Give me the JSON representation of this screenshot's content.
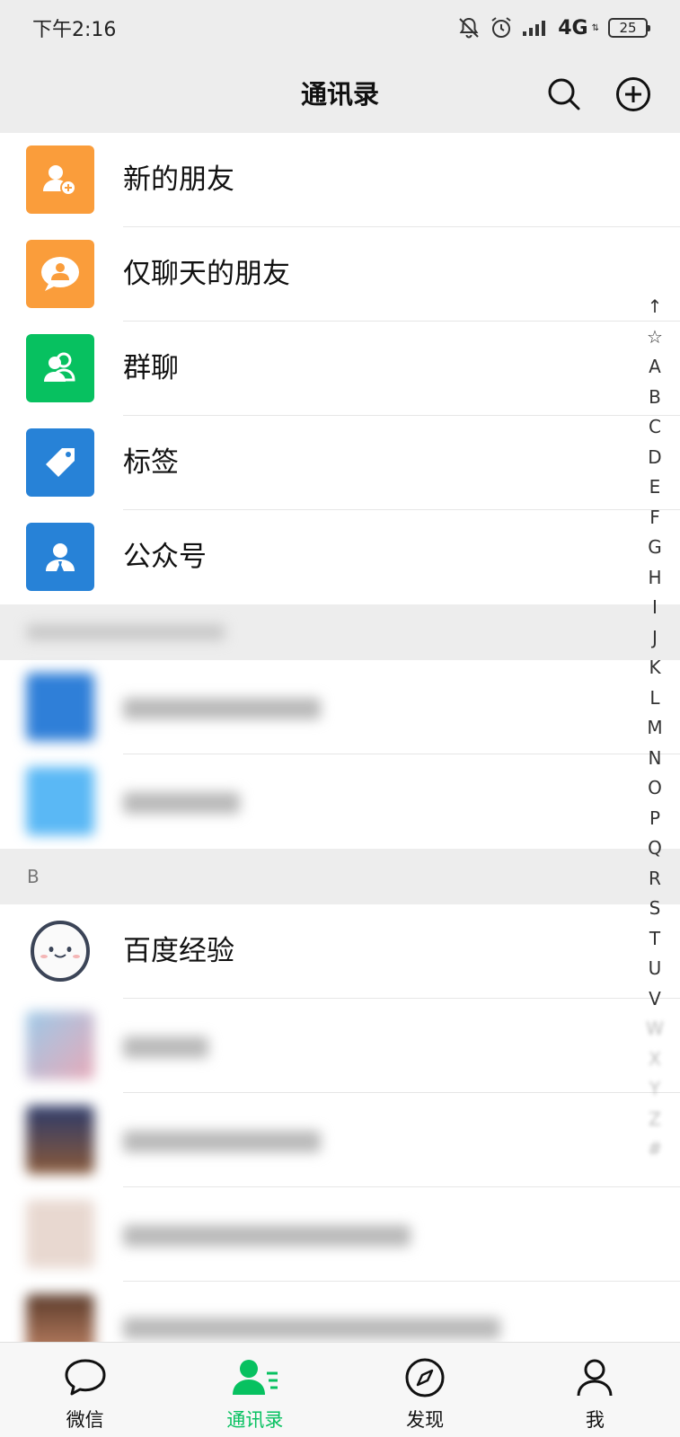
{
  "status_bar": {
    "time": "下午2:16",
    "network": "4G",
    "battery": "25"
  },
  "header": {
    "title": "通讯录"
  },
  "fixed_items": [
    {
      "label": "新的朋友",
      "color": "#fa9d3b",
      "icon": "add-friend-icon"
    },
    {
      "label": "仅聊天的朋友",
      "color": "#fa9d3b",
      "icon": "chat-only-friend-icon"
    },
    {
      "label": "群聊",
      "color": "#07c160",
      "icon": "group-chat-icon"
    },
    {
      "label": "标签",
      "color": "#2782d7",
      "icon": "tag-icon"
    },
    {
      "label": "公众号",
      "color": "#2782d7",
      "icon": "official-account-icon"
    }
  ],
  "sections": {
    "b_letter": "B"
  },
  "contacts": {
    "baidu_jingyan": "百度经验"
  },
  "alphabet_index": [
    "↑",
    "☆",
    "A",
    "B",
    "C",
    "D",
    "E",
    "F",
    "G",
    "H",
    "I",
    "J",
    "K",
    "L",
    "M",
    "N",
    "O",
    "P",
    "Q",
    "R",
    "S",
    "T",
    "U",
    "V"
  ],
  "tabs": [
    {
      "label": "微信",
      "icon": "chat-bubble-icon",
      "active": false
    },
    {
      "label": "通讯录",
      "icon": "contacts-icon",
      "active": true
    },
    {
      "label": "发现",
      "icon": "compass-icon",
      "active": false
    },
    {
      "label": "我",
      "icon": "person-icon",
      "active": false
    }
  ],
  "colors": {
    "accent": "#07c160",
    "orange": "#fa9d3b",
    "blue": "#2782d7",
    "background": "#ededed"
  }
}
